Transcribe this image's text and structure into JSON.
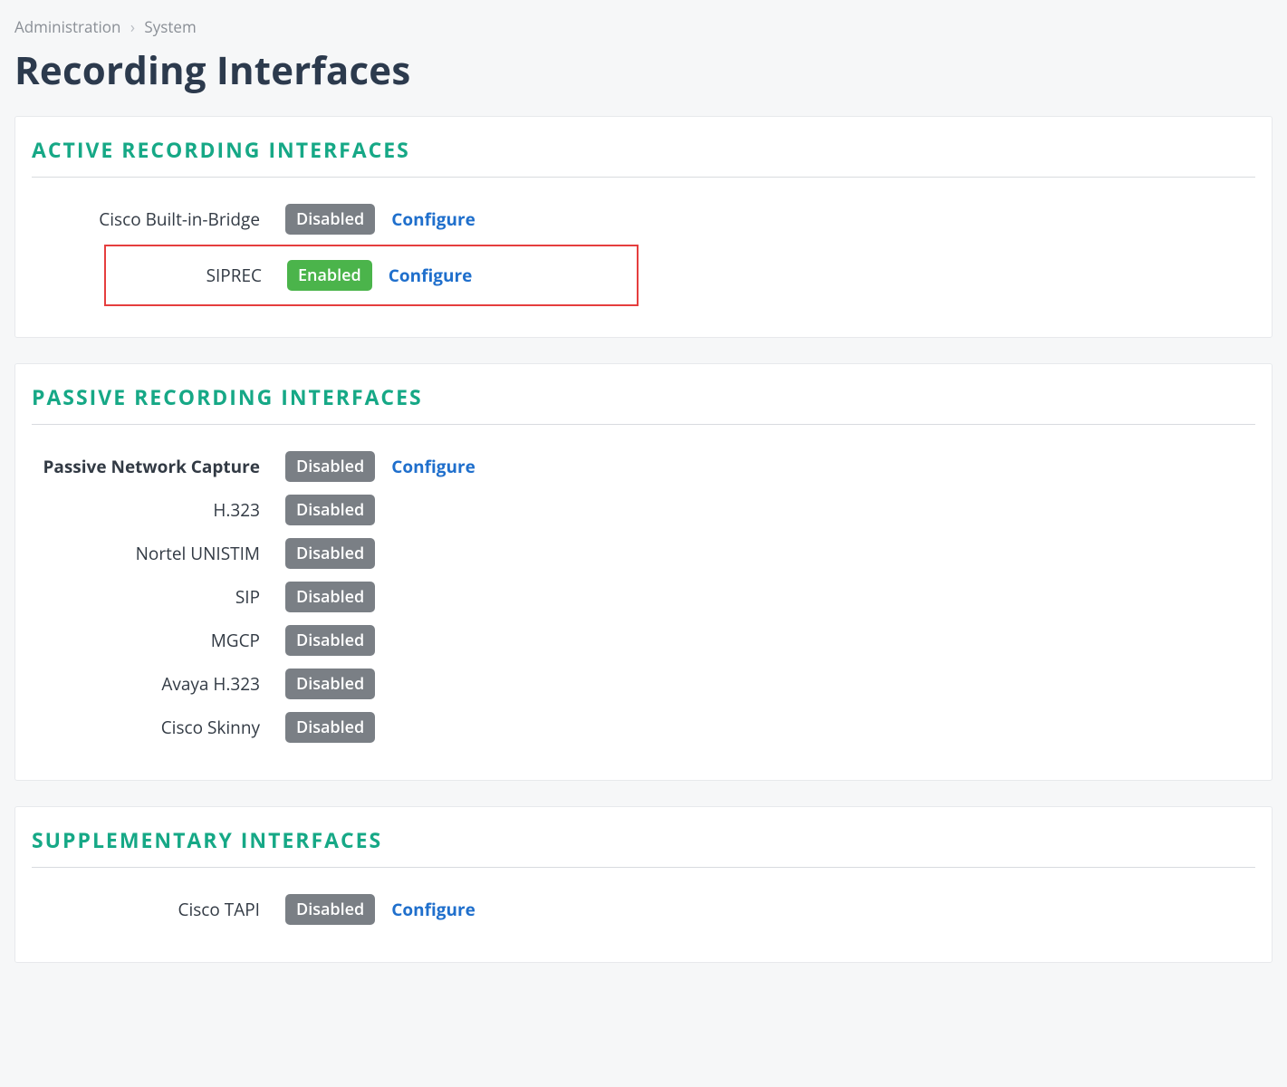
{
  "breadcrumb": {
    "a": "Administration",
    "b": "System"
  },
  "pageTitle": "Recording Interfaces",
  "configureLabel": "Configure",
  "status": {
    "enabled": "Enabled",
    "disabled": "Disabled"
  },
  "sections": {
    "active": {
      "title": "ACTIVE  RECORDING  INTERFACES",
      "items": [
        {
          "label": "Cisco Built-in-Bridge",
          "status": "disabled",
          "configurable": true
        },
        {
          "label": "SIPREC",
          "status": "enabled",
          "configurable": true,
          "highlighted": true
        }
      ]
    },
    "passive": {
      "title": "PASSIVE  RECORDING  INTERFACES",
      "items": [
        {
          "label": "Passive Network Capture",
          "status": "disabled",
          "configurable": true,
          "bold": true
        },
        {
          "label": "H.323",
          "status": "disabled"
        },
        {
          "label": "Nortel UNISTIM",
          "status": "disabled"
        },
        {
          "label": "SIP",
          "status": "disabled"
        },
        {
          "label": "MGCP",
          "status": "disabled"
        },
        {
          "label": "Avaya H.323",
          "status": "disabled"
        },
        {
          "label": "Cisco Skinny",
          "status": "disabled"
        }
      ]
    },
    "supplementary": {
      "title": "SUPPLEMENTARY  INTERFACES",
      "items": [
        {
          "label": "Cisco TAPI",
          "status": "disabled",
          "configurable": true
        }
      ]
    }
  }
}
